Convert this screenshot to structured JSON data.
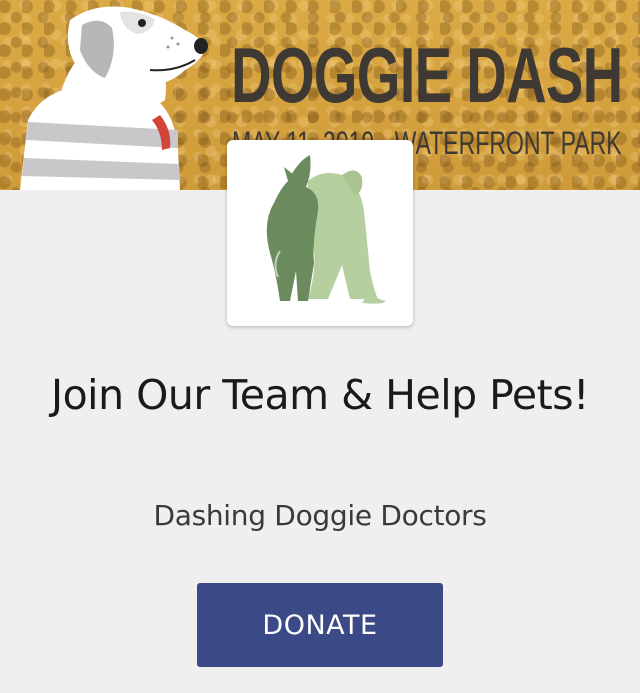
{
  "banner": {
    "event_title": "DOGGIE DASH",
    "event_subtitle": "MAY 11, 2019 · WATERFRONT PARK"
  },
  "logo": {
    "icon": "dog-and-cat-silhouette-icon",
    "colors": {
      "dark": "#6b8a5e",
      "light": "#b6cf9f"
    }
  },
  "team": {
    "title": "Join Our Team & Help Pets!",
    "name": "Dashing Doggie Doctors"
  },
  "actions": {
    "donate_label": "DONATE"
  },
  "colors": {
    "banner": "#d9a640",
    "title_ink": "#3e3a33",
    "button": "#3b4a86",
    "page_bg": "#efefef"
  }
}
